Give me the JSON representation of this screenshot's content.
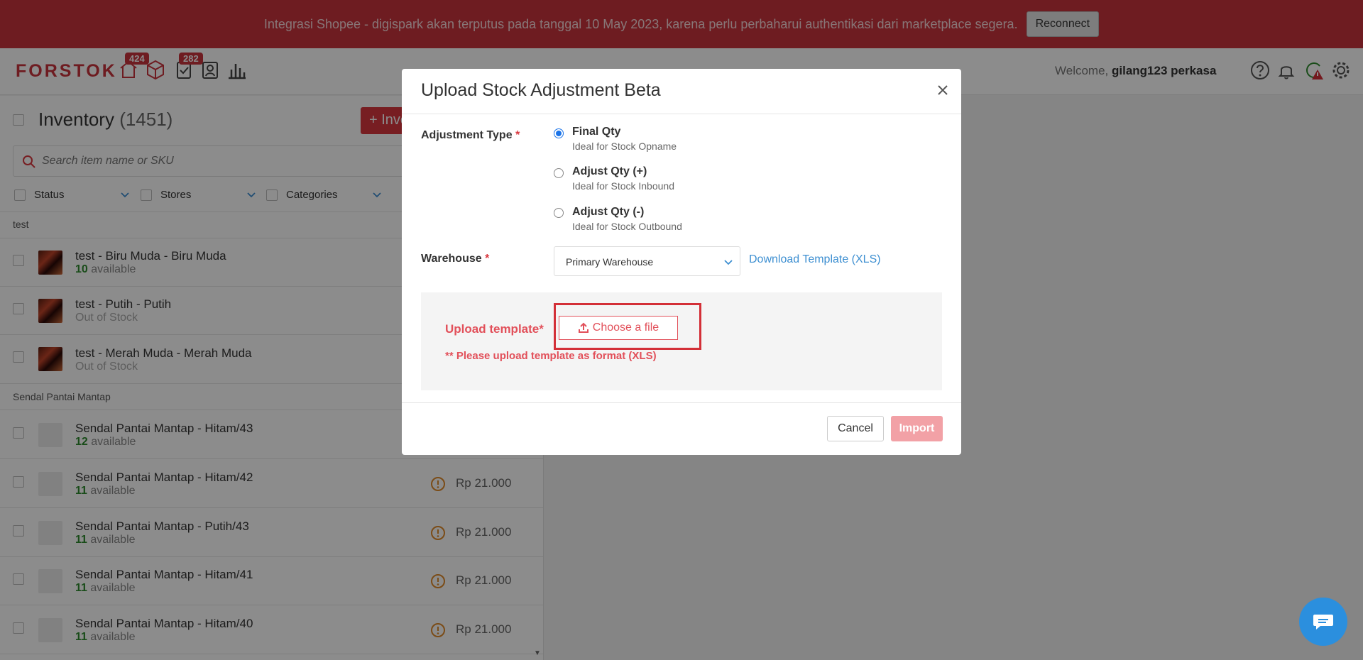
{
  "banner": {
    "message": "Integrasi Shopee - digispark akan terputus pada tanggal 10 May 2023, karena perlu perbaharui authentikasi dari marketplace segera.",
    "reconnect_label": "Reconnect"
  },
  "header": {
    "logo": "FORSTOK",
    "badge_orders": "424",
    "badge_tasks": "282",
    "welcome_prefix": "Welcome,",
    "username": "gilang123 perkasa"
  },
  "inventory": {
    "title": "Inventory",
    "count": "(1451)",
    "add_label": "+ Inventory",
    "search_placeholder": "Search item name or SKU",
    "filters": [
      "Status",
      "Stores",
      "Categories"
    ],
    "groups": [
      {
        "name": "test",
        "items": [
          {
            "name": "test - Biru Muda - Biru Muda",
            "qty": "10",
            "avail": "available",
            "status": "available"
          },
          {
            "name": "test - Putih - Putih",
            "qty": "",
            "avail": "Out of Stock",
            "status": "oos"
          },
          {
            "name": "test - Merah Muda - Merah Muda",
            "qty": "",
            "avail": "Out of Stock",
            "status": "oos"
          }
        ]
      },
      {
        "name": "Sendal Pantai Mantap",
        "items": [
          {
            "name": "Sendal Pantai Mantap - Hitam/43",
            "qty": "12",
            "avail": "available",
            "price": ""
          },
          {
            "name": "Sendal Pantai Mantap - Hitam/42",
            "qty": "11",
            "avail": "available",
            "price": "Rp 21.000"
          },
          {
            "name": "Sendal Pantai Mantap - Putih/43",
            "qty": "11",
            "avail": "available",
            "price": "Rp 21.000"
          },
          {
            "name": "Sendal Pantai Mantap - Hitam/41",
            "qty": "11",
            "avail": "available",
            "price": "Rp 21.000"
          },
          {
            "name": "Sendal Pantai Mantap - Hitam/40",
            "qty": "11",
            "avail": "available",
            "price": "Rp 21.000"
          }
        ]
      }
    ]
  },
  "modal": {
    "title": "Upload Stock Adjustment Beta",
    "adjustment_type_label": "Adjustment Type",
    "required_mark": "*",
    "options": [
      {
        "title": "Final Qty",
        "desc": "Ideal for Stock Opname",
        "selected": true
      },
      {
        "title": "Adjust Qty (+)",
        "desc": "Ideal for Stock Inbound",
        "selected": false
      },
      {
        "title": "Adjust Qty (-)",
        "desc": "Ideal for Stock Outbound",
        "selected": false
      }
    ],
    "warehouse_label": "Warehouse",
    "warehouse_value": "Primary Warehouse",
    "download_template": "Download Template (XLS)",
    "upload_label": "Upload template*",
    "choose_file": "Choose a file",
    "upload_note": "** Please upload template as format (XLS)",
    "cancel": "Cancel",
    "import": "Import"
  },
  "colors": {
    "brand_red": "#c8333d",
    "link_blue": "#3d8fd1",
    "available_green": "#2e8b2e",
    "chat_blue": "#2b8fde"
  }
}
